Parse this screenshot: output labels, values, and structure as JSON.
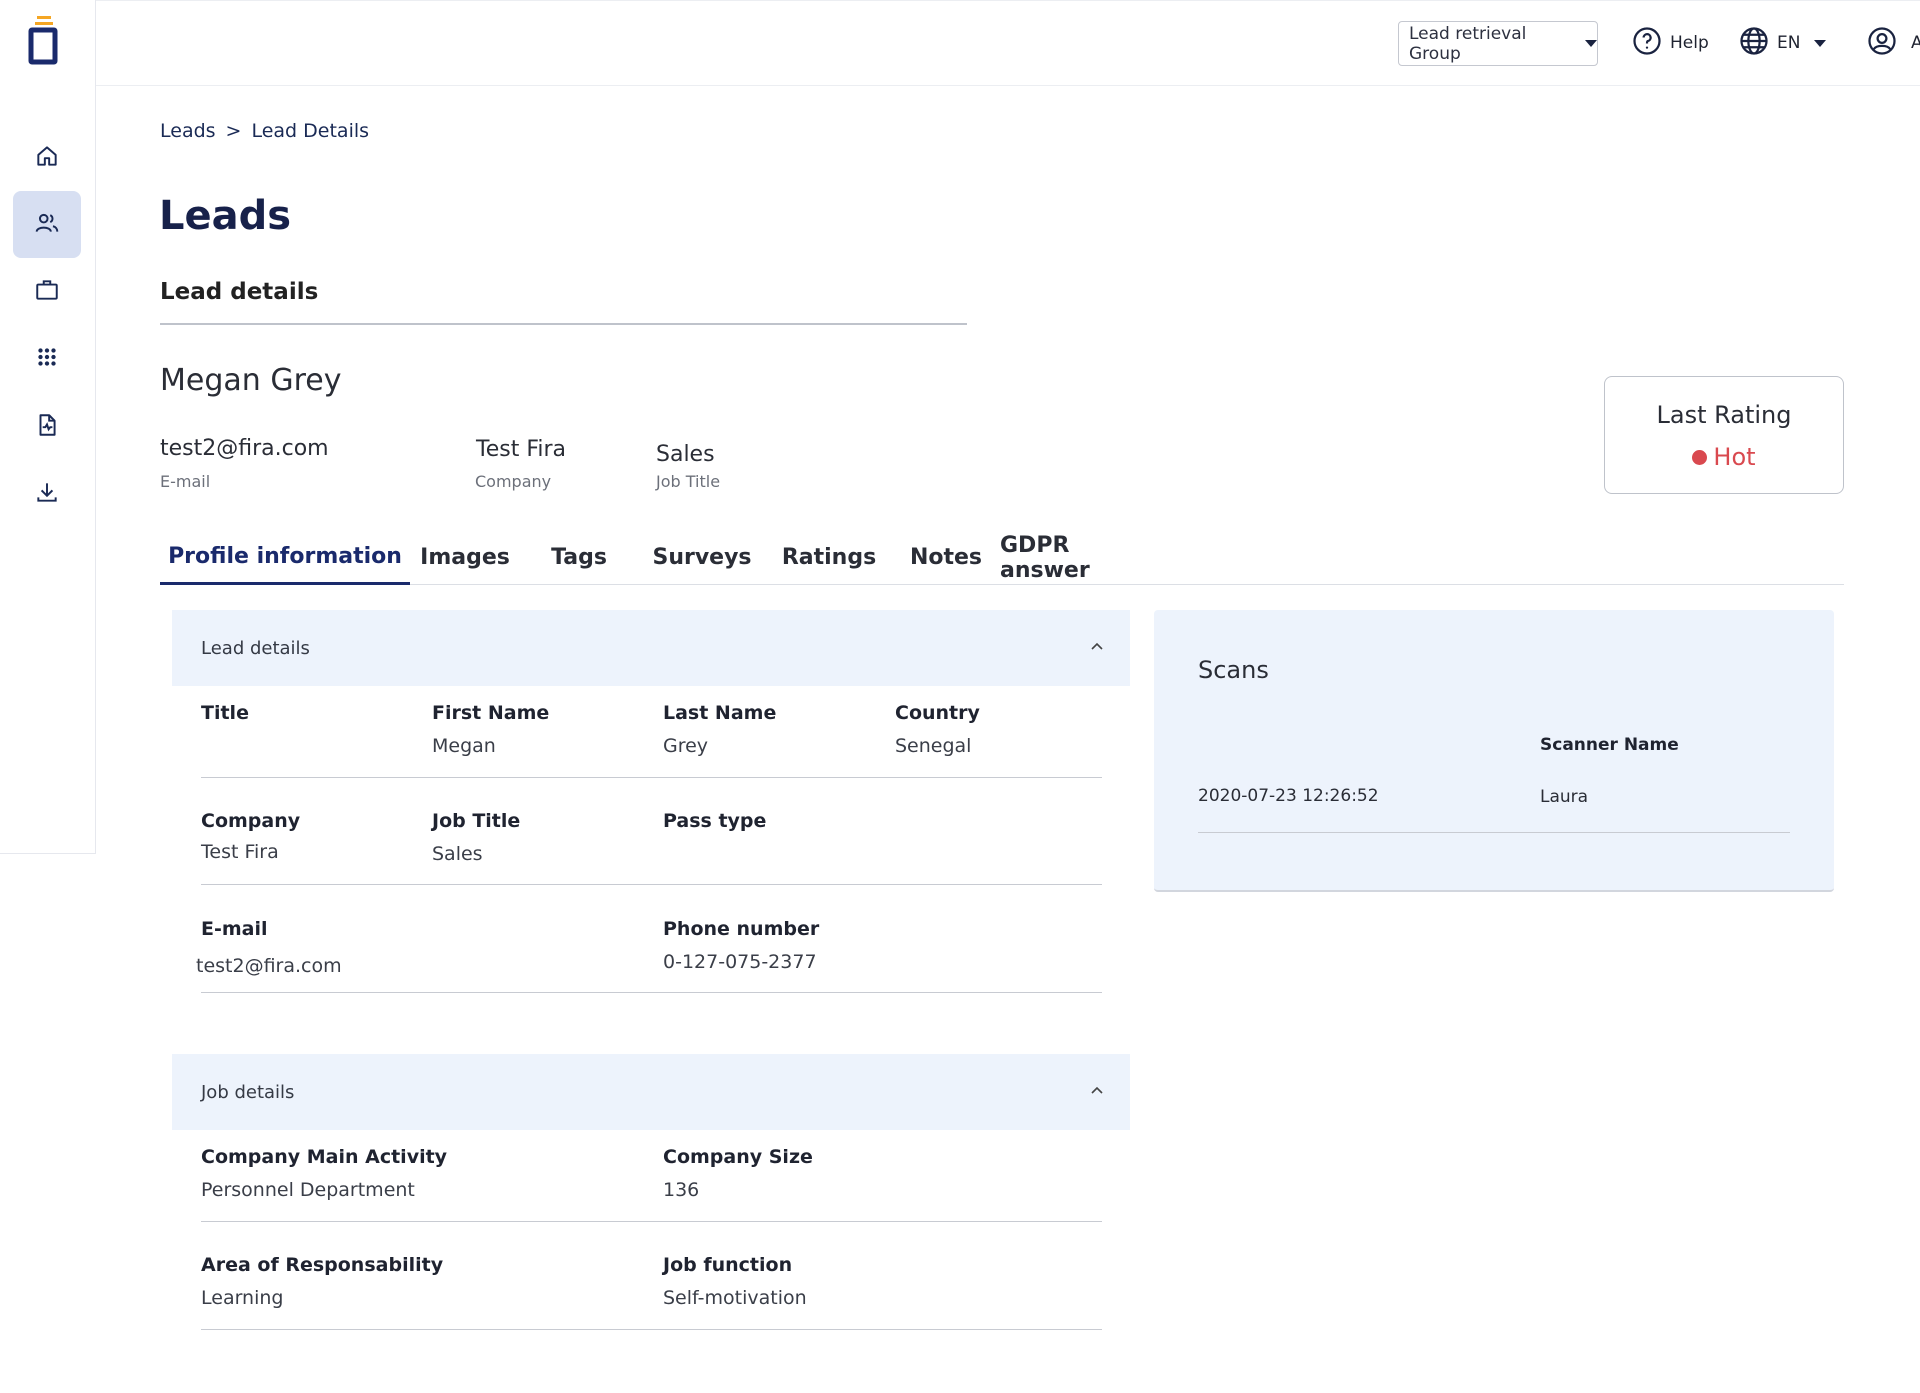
{
  "topbar": {
    "group_select": "Lead retrieval Group",
    "help_label": "Help",
    "language": "EN",
    "user_name": "Ashley"
  },
  "sidebar": {
    "items": [
      {
        "icon": "home-icon",
        "active": false
      },
      {
        "icon": "users-icon",
        "active": true
      },
      {
        "icon": "briefcase-icon",
        "active": false
      },
      {
        "icon": "apps-grid-icon",
        "active": false
      },
      {
        "icon": "report-document-icon",
        "active": false
      },
      {
        "icon": "download-icon",
        "active": false
      }
    ]
  },
  "breadcrumb": {
    "root": "Leads",
    "separator": ">",
    "current": "Lead Details"
  },
  "page_title": "Leads",
  "section_title": "Lead details",
  "lead": {
    "name": "Megan Grey",
    "email": "test2@fira.com",
    "email_label": "E-mail",
    "company": "Test Fira",
    "company_label": "Company",
    "job_title": "Sales",
    "job_title_label": "Job Title"
  },
  "rating": {
    "title": "Last Rating",
    "value": "Hot",
    "color": "#d9494f"
  },
  "tabs": [
    "Profile information",
    "Images",
    "Tags",
    "Surveys",
    "Ratings",
    "Notes",
    "GDPR answer"
  ],
  "lead_details_panel": {
    "header": "Lead details",
    "title_label": "Title",
    "first_name_label": "First Name",
    "first_name": "Megan",
    "last_name_label": "Last Name",
    "last_name": "Grey",
    "country_label": "Country",
    "country": "Senegal",
    "company_label": "Company",
    "company": "Test Fira",
    "job_title_label": "Job Title",
    "job_title": "Sales",
    "pass_type_label": "Pass type",
    "email_label": "E-mail",
    "email": "test2@fira.com",
    "phone_label": "Phone number",
    "phone": "0-127-075-2377"
  },
  "job_details_panel": {
    "header": "Job details",
    "activity_label": "Company Main Activity",
    "activity": "Personnel Department",
    "size_label": "Company Size",
    "size": "136",
    "area_label": "Area of Responsability",
    "area": "Learning",
    "function_label": "Job function",
    "function": "Self-motivation"
  },
  "scans": {
    "title": "Scans",
    "scanner_header": "Scanner Name",
    "rows": [
      {
        "date": "2020-07-23 12:26:52",
        "scanner": "Laura"
      }
    ]
  },
  "colors": {
    "accent": "#1a2a6c",
    "panel_bg": "#edf3fc",
    "sidebar_active": "#d7dff2",
    "logo_orange": "#f5a623"
  }
}
